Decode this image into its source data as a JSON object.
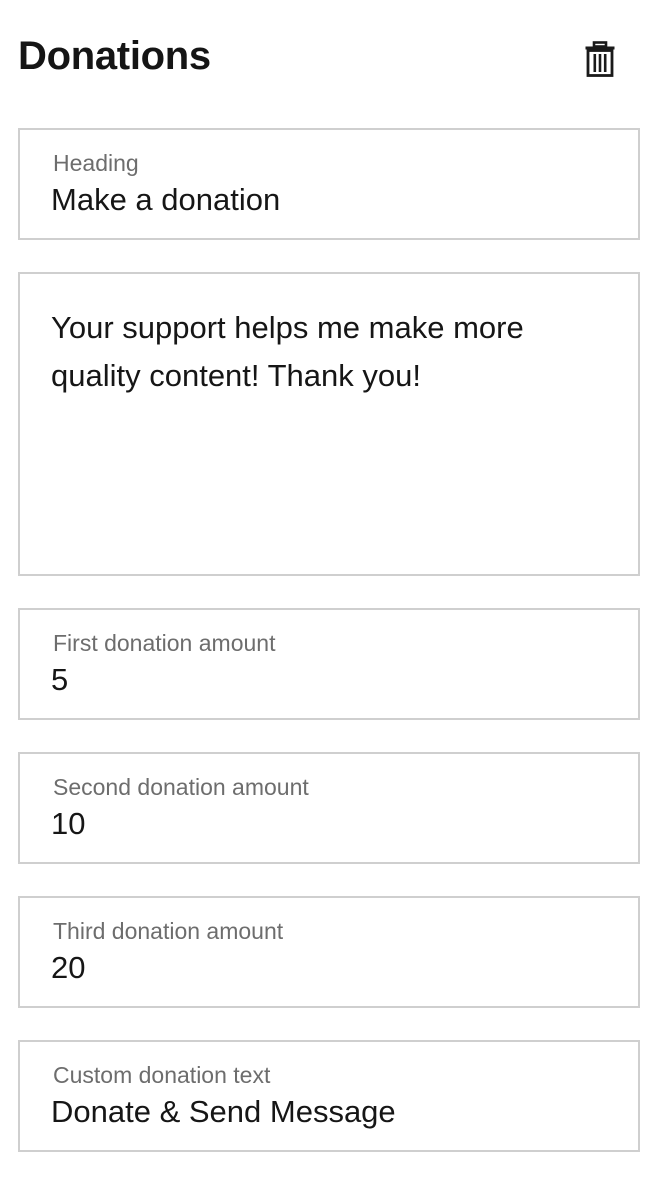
{
  "header": {
    "title": "Donations",
    "delete_icon": "trash-icon"
  },
  "fields": {
    "heading": {
      "label": "Heading",
      "value": "Make a donation"
    },
    "description": {
      "value": "Your support helps me make more quality content! Thank you!"
    },
    "first_amount": {
      "label": "First donation amount",
      "value": "5"
    },
    "second_amount": {
      "label": "Second donation amount",
      "value": "10"
    },
    "third_amount": {
      "label": "Third donation amount",
      "value": "20"
    },
    "custom_text": {
      "label": "Custom donation text",
      "value": "Donate & Send Message"
    }
  },
  "colors": {
    "border": "#cfcfcf",
    "label": "#6d6d6d",
    "text": "#161616"
  }
}
